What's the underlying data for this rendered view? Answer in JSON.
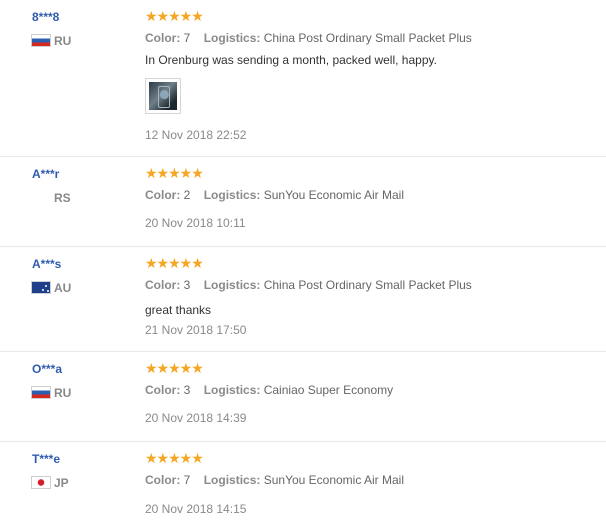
{
  "labels": {
    "color": "Color:",
    "logistics": "Logistics:"
  },
  "reviews": [
    {
      "buyer": "8***8",
      "country": "RU",
      "flag": "russia-flag-icon",
      "stars": "★★★★★",
      "color": "7",
      "logistics": "China Post Ordinary Small Packet Plus",
      "comment": "In Orenburg was sending a month, packed well, happy.",
      "has_photo": true,
      "date": "12 Nov 2018 22:52"
    },
    {
      "buyer": "A***r",
      "country": "RS",
      "flag": "",
      "stars": "★★★★★",
      "color": "2",
      "logistics": "SunYou Economic Air Mail",
      "comment": "",
      "date": "20 Nov 2018 10:11"
    },
    {
      "buyer": "A***s",
      "country": "AU",
      "flag": "australia-flag-icon",
      "stars": "★★★★★",
      "color": "3",
      "logistics": "China Post Ordinary Small Packet Plus",
      "comment": "great thanks",
      "date": "21 Nov 2018 17:50"
    },
    {
      "buyer": "O***a",
      "country": "RU",
      "flag": "russia-flag-icon",
      "stars": "★★★★★",
      "color": "3",
      "logistics": "Cainiao Super Economy",
      "comment": "",
      "date": "20 Nov 2018 14:39"
    },
    {
      "buyer": "T***e",
      "country": "JP",
      "flag": "japan-flag-icon",
      "stars": "★★★★★",
      "color": "7",
      "logistics": "SunYou Economic Air Mail",
      "comment": "",
      "date": "20 Nov 2018 14:15"
    }
  ],
  "colors": {
    "buyer_name": "#2f5cae",
    "stars": "#f5a623",
    "label": "#8a8a8a"
  }
}
